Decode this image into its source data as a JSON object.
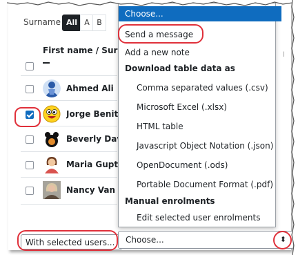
{
  "filter": {
    "surname_label": "Surname",
    "letters": [
      "All",
      "A",
      "B"
    ]
  },
  "table": {
    "first_name_header": "First name / Surname",
    "rows": [
      {
        "name": "Ahmed Ali",
        "checked": false,
        "avatar": "blue-figure"
      },
      {
        "name": "Jorge Benitez",
        "checked": true,
        "avatar": "smiley"
      },
      {
        "name": "Beverly Davis",
        "checked": false,
        "avatar": "bear"
      },
      {
        "name": "Maria Gupta",
        "checked": false,
        "avatar": "woman"
      },
      {
        "name": "Nancy Van",
        "checked": false,
        "avatar": "photo"
      }
    ]
  },
  "bulk": {
    "with_selected_label": "With selected users...",
    "select_value": "Choose..."
  },
  "dropdown": {
    "items": [
      {
        "label": "Choose...",
        "type": "highlight"
      },
      {
        "label": "Send a message",
        "type": "option"
      },
      {
        "label": "Add a new note",
        "type": "option"
      },
      {
        "label": "Download table data as",
        "type": "group"
      },
      {
        "label": "Comma separated values (.csv)",
        "type": "sub"
      },
      {
        "label": "Microsoft Excel (.xlsx)",
        "type": "sub"
      },
      {
        "label": "HTML table",
        "type": "sub"
      },
      {
        "label": "Javascript Object Notation (.json)",
        "type": "sub"
      },
      {
        "label": "OpenDocument (.ods)",
        "type": "sub"
      },
      {
        "label": "Portable Document Format (.pdf)",
        "type": "sub"
      },
      {
        "label": "Manual enrolments",
        "type": "group"
      },
      {
        "label": "Edit selected user enrolments",
        "type": "sub"
      }
    ]
  },
  "colors": {
    "accent": "#0f6cbf",
    "callout": "#e0303a"
  }
}
